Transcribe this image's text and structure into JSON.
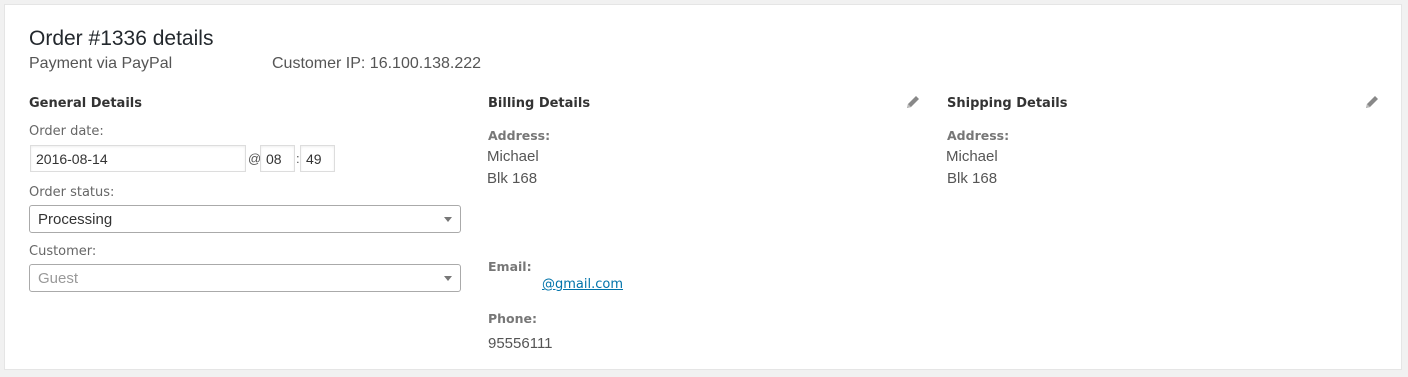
{
  "order": {
    "title": "Order #1336 details",
    "payment": "Payment via PayPal",
    "customer_ip": "Customer IP: 16.100.138.222"
  },
  "general": {
    "heading": "General Details",
    "order_date_label": "Order date:",
    "date_value": "2016-08-14",
    "at_symbol": "@",
    "hour_value": "08",
    "time_separator": ":",
    "minute_value": "49",
    "status_label": "Order status:",
    "status_value": "Processing",
    "customer_label": "Customer:",
    "customer_value": "Guest"
  },
  "billing": {
    "heading": "Billing Details",
    "address_label": "Address:",
    "address_lines": [
      "Michael",
      "Blk 168"
    ],
    "email_label": "Email:",
    "email_value": "@gmail.com",
    "phone_label": "Phone:",
    "phone_value": "95556111",
    "edit_icon": "pencil-icon"
  },
  "shipping": {
    "heading": "Shipping Details",
    "address_label": "Address:",
    "address_lines": [
      "Michael",
      "Blk 168"
    ],
    "edit_icon": "pencil-icon"
  },
  "colors": {
    "link": "#0073aa",
    "page_bg": "#f1f1f1",
    "panel_bg": "#ffffff"
  }
}
